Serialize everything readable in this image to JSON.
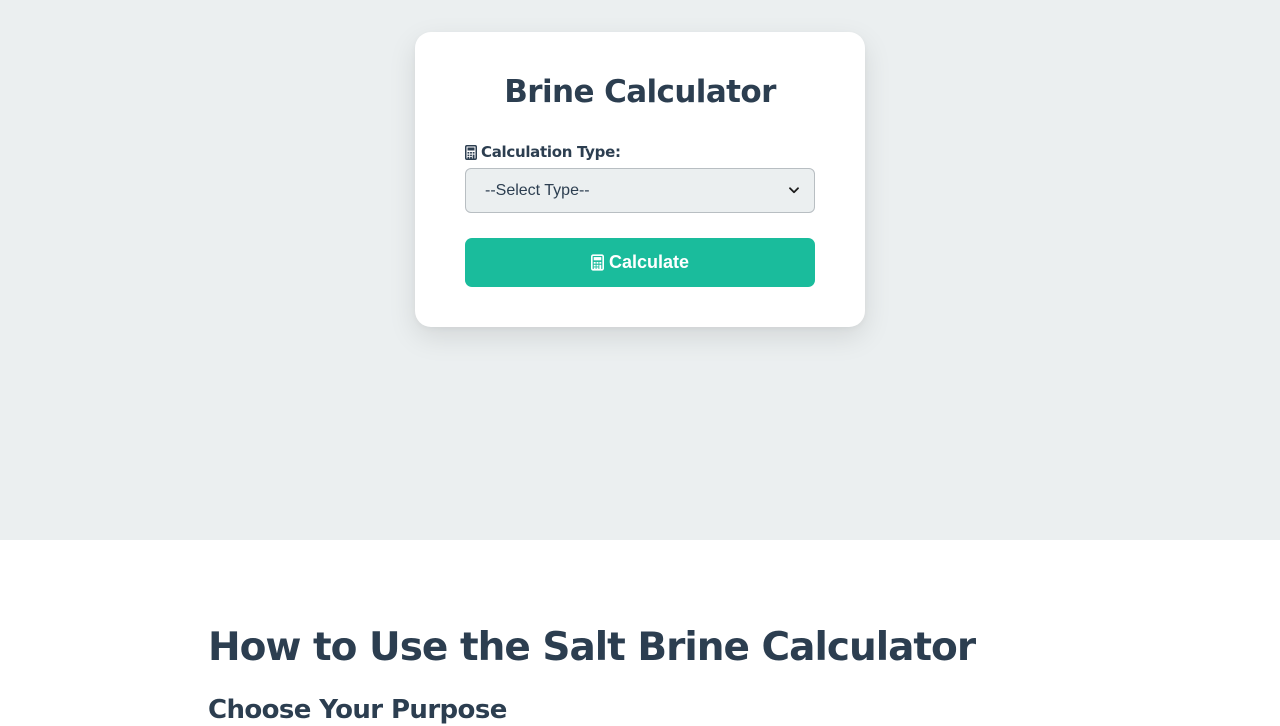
{
  "calculator": {
    "title": "Brine Calculator",
    "type_label": "Calculation Type:",
    "type_select_value": "--Select Type--",
    "calculate_label": "Calculate",
    "accent_color": "#1abc9c",
    "label_icon": "calculator-icon",
    "button_icon": "calculator-icon"
  },
  "article": {
    "title": "How to Use the Salt Brine Calculator",
    "subtitle": "Choose Your Purpose"
  },
  "colors": {
    "hero_background": "#ebeff0",
    "text": "#2c3e50",
    "card_background": "#ffffff"
  }
}
